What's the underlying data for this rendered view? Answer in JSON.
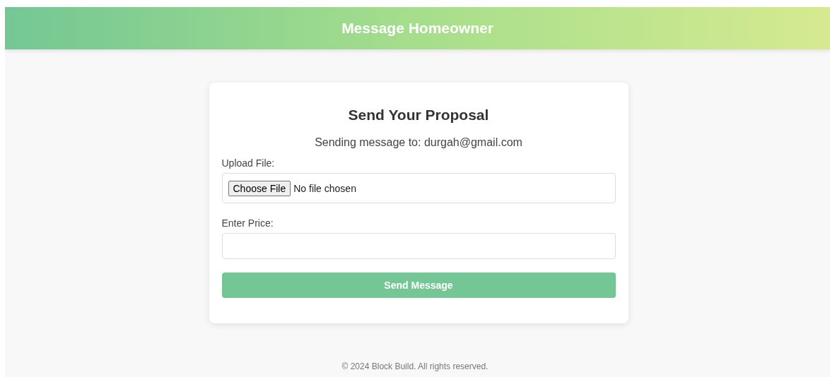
{
  "header": {
    "title": "Message Homeowner"
  },
  "card": {
    "title": "Send Your Proposal",
    "recipient": "Sending message to: durgah@gmail.com",
    "fields": [
      {
        "kind": "file",
        "label": "Upload File:",
        "button": "Choose File",
        "status": "No file chosen"
      },
      {
        "kind": "text",
        "label": "Enter Price:"
      }
    ],
    "submit": "Send Message"
  },
  "footer": "© 2024 Block Build. All rights reserved."
}
